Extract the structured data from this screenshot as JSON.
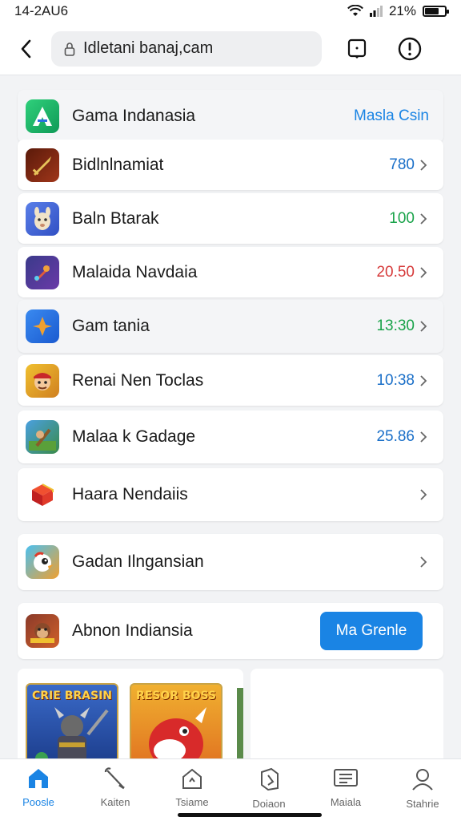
{
  "status_bar": {
    "time": "14-2AU6",
    "battery_pct": "21%",
    "battery_level": 0.7
  },
  "browser": {
    "url": "Idletani banaj,cam"
  },
  "rows": [
    {
      "label": "Gama Indanasia",
      "value": "Masla Csin",
      "value_color": "#1a84e4",
      "icon": "green-triangle-icon",
      "highlight": true,
      "chevron": false
    },
    {
      "label": "Bidlnlnamiat",
      "value": "780",
      "value_color": "#1a6fc8",
      "icon": "sword-icon",
      "highlight": false,
      "chevron": true
    },
    {
      "label": "Baln Btarak",
      "value": "100",
      "value_color": "#1aa34a",
      "icon": "llama-icon",
      "highlight": false,
      "chevron": true
    },
    {
      "label": "Malaida Navdaia",
      "value": "20.50",
      "value_color": "#d63a3a",
      "icon": "rocket-icon",
      "highlight": false,
      "chevron": true
    },
    {
      "label": "Gam tania",
      "value": "13:30",
      "value_color": "#1aa34a",
      "icon": "star-icon",
      "highlight": true,
      "chevron": true
    },
    {
      "label": "Renai Nen Toclas",
      "value": "10:38",
      "value_color": "#1a6fc8",
      "icon": "pirate-icon",
      "highlight": false,
      "chevron": true
    },
    {
      "label": "Malaa k Gadage",
      "value": "25.86",
      "value_color": "#1a6fc8",
      "icon": "warrior-icon",
      "highlight": false,
      "chevron": true
    },
    {
      "label": "Haara Nendaiis",
      "value": "",
      "value_color": "#1a6fc8",
      "icon": "cube-icon",
      "highlight": false,
      "chevron": true
    },
    {
      "label": "Gadan Ilngansian",
      "value": "",
      "value_color": "#1a6fc8",
      "icon": "bird-icon",
      "highlight": false,
      "chevron": true
    },
    {
      "label": "Abnon Indiansia",
      "button": "Ma Grenle",
      "icon": "monkey-icon",
      "highlight": false,
      "chevron": true
    }
  ],
  "featured": [
    {
      "title": "CRIE BRASIN",
      "art": "knight-art"
    },
    {
      "title": "RESOR BOSS",
      "art": "dragon-art"
    }
  ],
  "tabs": [
    {
      "label": "Poosle",
      "icon": "home-icon",
      "active": true
    },
    {
      "label": "Kaiten",
      "icon": "tools-icon",
      "active": false
    },
    {
      "label": "Tsiame",
      "icon": "house-tag-icon",
      "active": false
    },
    {
      "label": "Doiaon",
      "icon": "document-icon",
      "active": false
    },
    {
      "label": "Maiala",
      "icon": "list-icon",
      "active": false
    },
    {
      "label": "Stahrie",
      "icon": "profile-icon",
      "active": false
    }
  ],
  "colors": {
    "accent": "#1a84e4",
    "green": "#1aa34a",
    "red": "#d63a3a"
  }
}
